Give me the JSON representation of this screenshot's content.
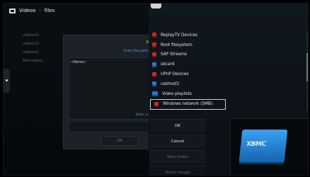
{
  "header": {
    "title": "Videos",
    "separator": "-",
    "section": "files"
  },
  "left_list": [
    "usbhost1",
    "usbhost1",
    "usbhost1",
    "Add videos..."
  ],
  "dialog": {
    "title": "Ad",
    "hint_top": "Enter the paths o",
    "selected_path": "<None>",
    "hint_bottom": "Enter a n",
    "ok_label": "OK"
  },
  "sources": [
    {
      "label": "ReplayTV Devices",
      "icon": "red-drive-icon"
    },
    {
      "label": "Root filesystem",
      "icon": "red-drive-icon"
    },
    {
      "label": "SAP Streams",
      "icon": "red-drive-icon"
    },
    {
      "label": "sdcard",
      "icon": "blue-drive-icon"
    },
    {
      "label": "UPnP Devices",
      "icon": "red-drive-icon"
    },
    {
      "label": "usbhost1",
      "icon": "blue-drive-icon"
    },
    {
      "label": "Video playlists",
      "icon": "playlist-icon"
    },
    {
      "label": "Windows network (SMB)",
      "icon": "red-drive-icon"
    }
  ],
  "buttons": {
    "ok": "OK",
    "cancel": "Cancel",
    "new_folder": "New folder",
    "mirror_image": "Mirror image"
  },
  "preview": {
    "logo_text": "XBMC"
  },
  "colors": {
    "accent_orange": "#e6a520",
    "accent_blue": "#5aa6d8",
    "red_icon": "#c8282b",
    "blue_icon": "#2d75c9"
  }
}
